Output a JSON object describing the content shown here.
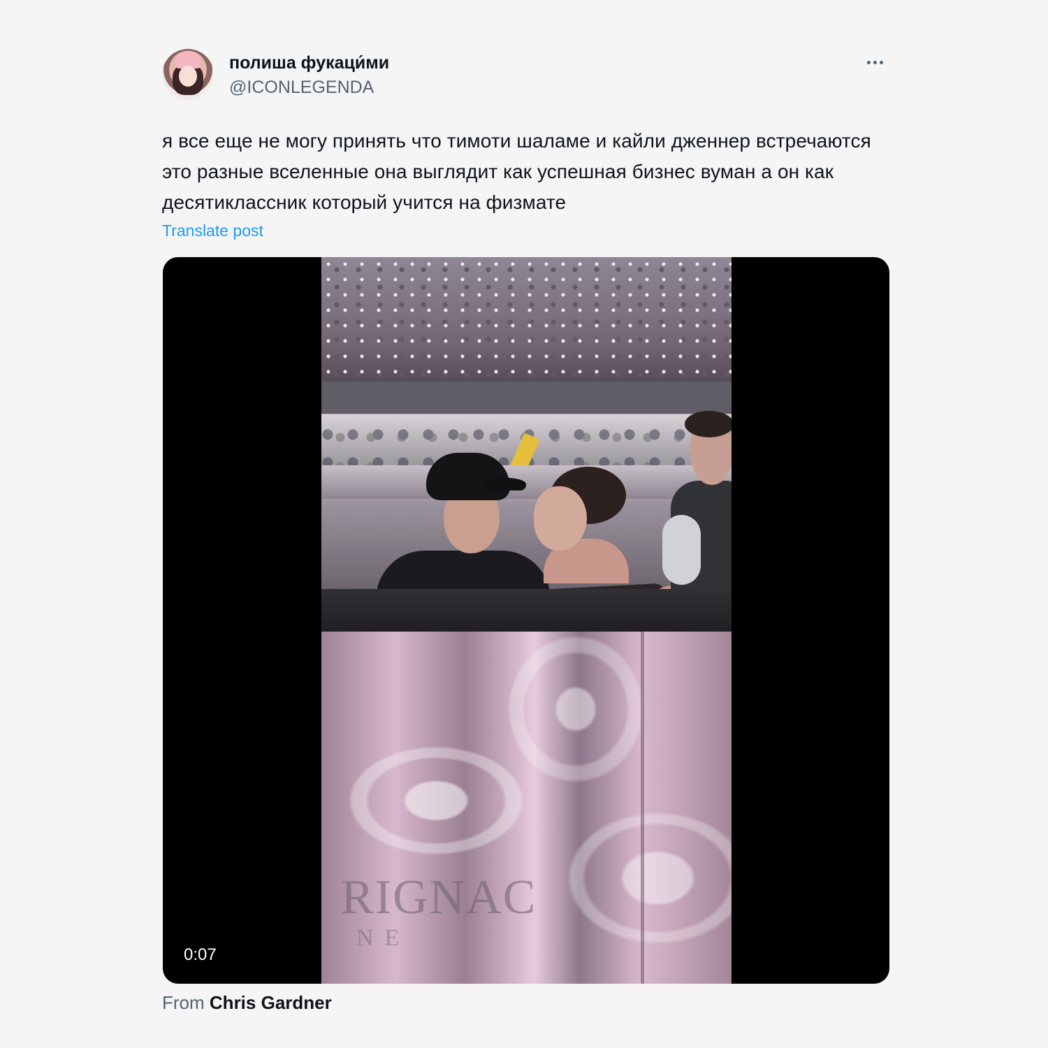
{
  "author": {
    "display_name": "полиша фукаци́ми",
    "handle": "@ICONLEGENDA"
  },
  "post": {
    "text": "я все еще не могу принять что тимоти шаламе и кайли дженнер встречаются это разные вселенные она выглядит как успешная бизнес вуман а он как десятиклассник который учится на физмате",
    "translate_label": "Translate post"
  },
  "media": {
    "duration": "0:07",
    "logo_text": "RIGNAC",
    "logo_subtext": "NE"
  },
  "source": {
    "prefix": "From",
    "name": "Chris Gardner"
  },
  "icons": {
    "more": "more-horizontal-icon"
  },
  "colors": {
    "background": "#f5f5f5",
    "text_primary": "#0f1419",
    "text_secondary": "#536471",
    "link": "#1d9bf0",
    "media_background": "#000000"
  }
}
